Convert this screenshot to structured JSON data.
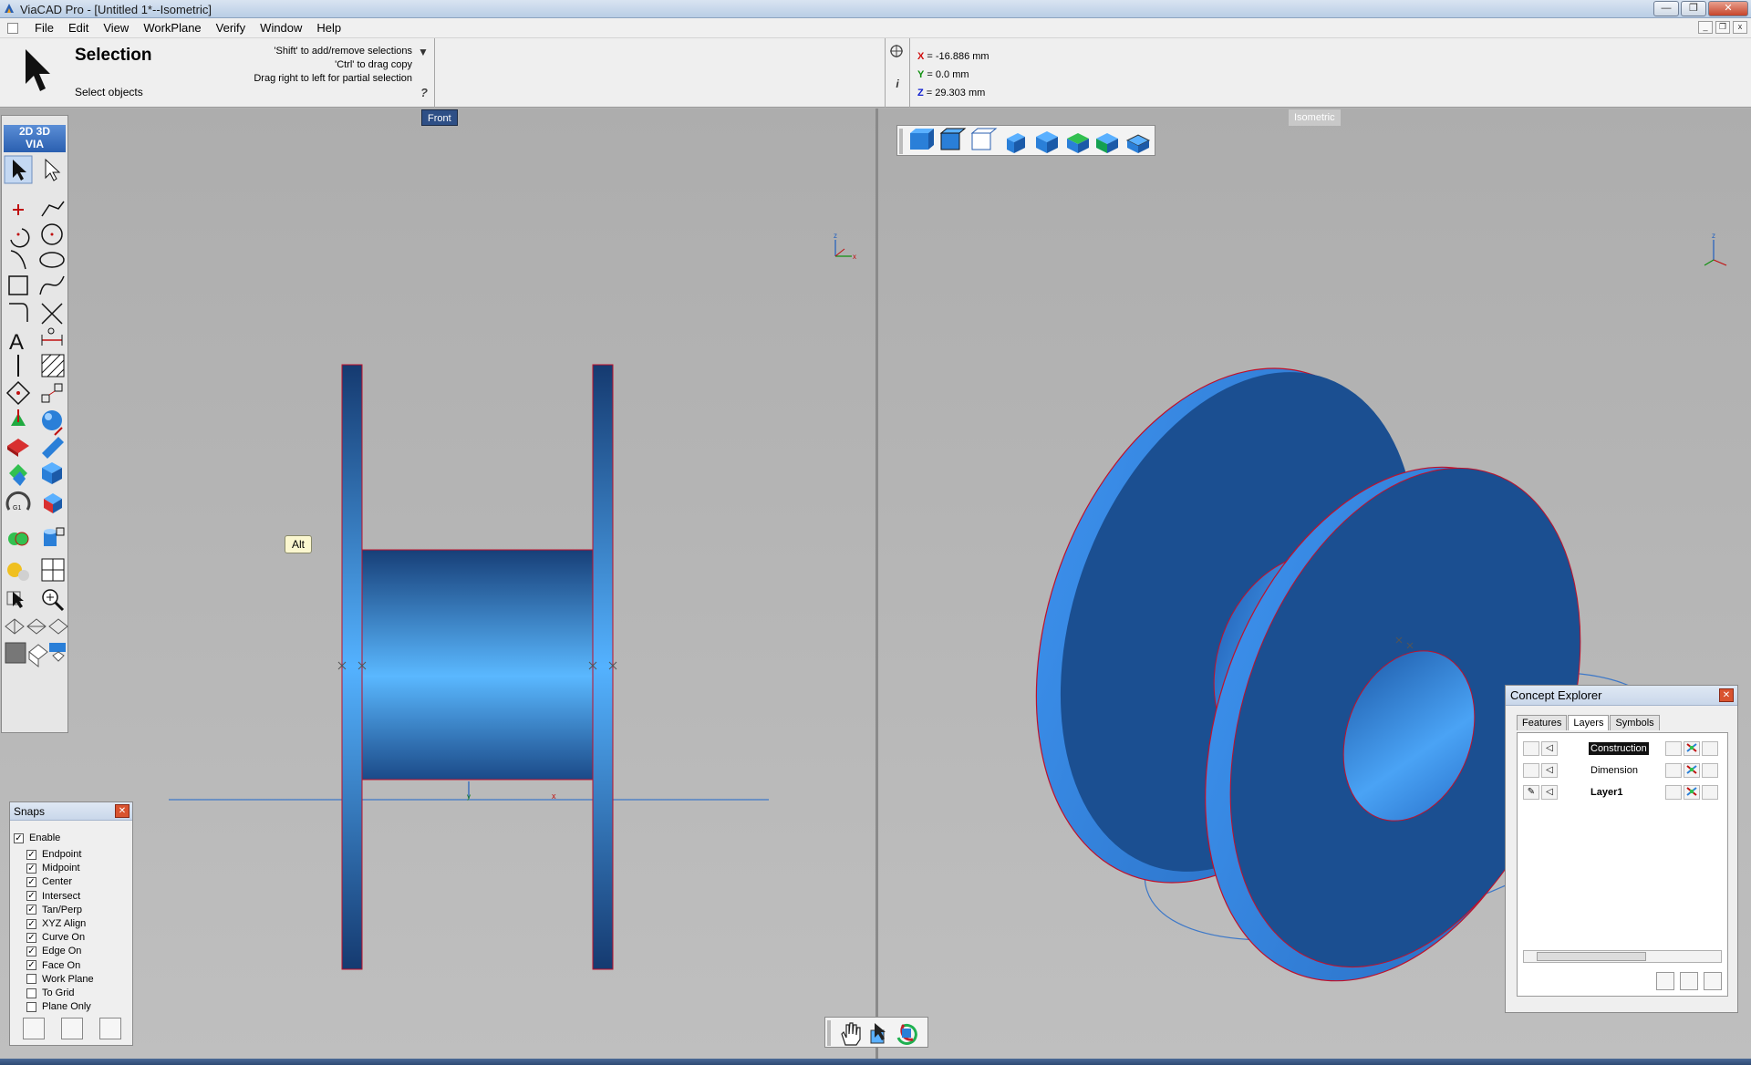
{
  "window": {
    "title": "ViaCAD Pro - [Untitled 1*--Isometric]",
    "min_label": "—",
    "max_label": "❐",
    "close_label": "✕"
  },
  "menu": {
    "items": [
      "File",
      "Edit",
      "View",
      "WorkPlane",
      "Verify",
      "Window",
      "Help"
    ]
  },
  "inspector": {
    "title": "Selection",
    "subtitle": "Select objects",
    "hints": [
      "'Shift' to add/remove selections",
      "'Ctrl' to drag copy",
      "Drag right to left for partial selection"
    ],
    "help_label": "?",
    "coords": {
      "x_label": "X",
      "x_value": " = -16.886 mm",
      "y_label": "Y",
      "y_value": " = 0.0 mm",
      "z_label": "Z",
      "z_value": " = 29.303 mm"
    },
    "info_label": "i"
  },
  "viewports": {
    "front_label": "Front",
    "iso_label": "Isometric"
  },
  "palette": {
    "logo_top": "2D 3D",
    "logo_bottom": "VIA"
  },
  "tooltip": "Alt",
  "snaps": {
    "title": "Snaps",
    "enable": {
      "label": "Enable",
      "checked": true
    },
    "items": [
      {
        "label": "Endpoint",
        "checked": true
      },
      {
        "label": "Midpoint",
        "checked": true
      },
      {
        "label": "Center",
        "checked": true
      },
      {
        "label": "Intersect",
        "checked": true
      },
      {
        "label": "Tan/Perp",
        "checked": true
      },
      {
        "label": "XYZ Align",
        "checked": true
      },
      {
        "label": "Curve On",
        "checked": true
      },
      {
        "label": "Edge On",
        "checked": true
      },
      {
        "label": "Face On",
        "checked": true
      },
      {
        "label": "Work Plane",
        "checked": false
      },
      {
        "label": "To Grid",
        "checked": false
      },
      {
        "label": "Plane Only",
        "checked": false
      }
    ]
  },
  "concept_explorer": {
    "title": "Concept Explorer",
    "tabs": [
      {
        "label": "Features",
        "active": false
      },
      {
        "label": "Layers",
        "active": true
      },
      {
        "label": "Symbols",
        "active": false
      }
    ],
    "layers": [
      {
        "name": "Construction",
        "selected": true,
        "bold": false
      },
      {
        "name": "Dimension",
        "selected": false,
        "bold": false
      },
      {
        "name": "Layer1",
        "selected": false,
        "bold": true
      }
    ]
  },
  "colors": {
    "model_blue": "#2a6fc4",
    "model_dark": "#1b4f91",
    "model_light": "#4aa3f5",
    "edge_red": "#c0102a"
  }
}
